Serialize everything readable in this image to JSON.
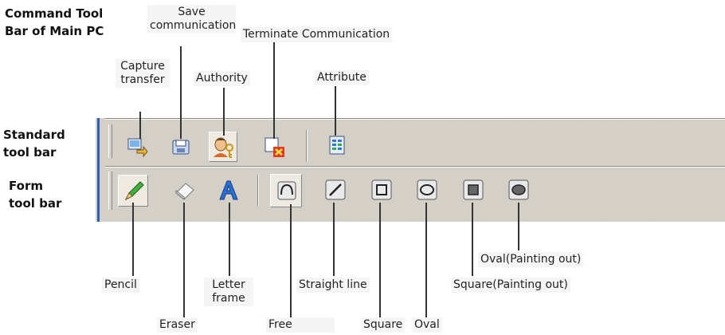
{
  "heading": {
    "line1": "Command Tool",
    "line2": "Bar of Main PC"
  },
  "row_labels": {
    "standard": {
      "line1": "Standard",
      "line2": "tool bar"
    },
    "form": {
      "line1": "Form",
      "line2": "tool bar"
    }
  },
  "standard_buttons": [
    {
      "icon": "capture-transfer-icon",
      "label_line1": "Capture",
      "label_line2": "transfer"
    },
    {
      "icon": "save-communication-icon",
      "label_line1": "Save",
      "label_line2": "communication"
    },
    {
      "icon": "authority-icon",
      "label": "Authority"
    },
    {
      "icon": "terminate-communication-icon",
      "label": "Terminate Communication"
    },
    {
      "icon": "attribute-icon",
      "label": "Attribute"
    }
  ],
  "form_buttons": [
    {
      "icon": "pencil-icon",
      "label": "Pencil"
    },
    {
      "icon": "eraser-icon",
      "label": "Eraser"
    },
    {
      "icon": "letter-frame-icon",
      "label_line1": "Letter",
      "label_line2": "frame"
    },
    {
      "icon": "free-icon",
      "label": "Free"
    },
    {
      "icon": "straight-line-icon",
      "label": "Straight line"
    },
    {
      "icon": "square-icon",
      "label": "Square"
    },
    {
      "icon": "oval-icon",
      "label": "Oval"
    },
    {
      "icon": "square-painting-out-icon",
      "label": "Square(Painting out)"
    },
    {
      "icon": "oval-painting-out-icon",
      "label": "Oval(Painting out)"
    }
  ],
  "colors": {
    "toolbar": "#d4d0c8",
    "grip": "#2f5fb3",
    "label_bg": "#f5f5f5"
  }
}
